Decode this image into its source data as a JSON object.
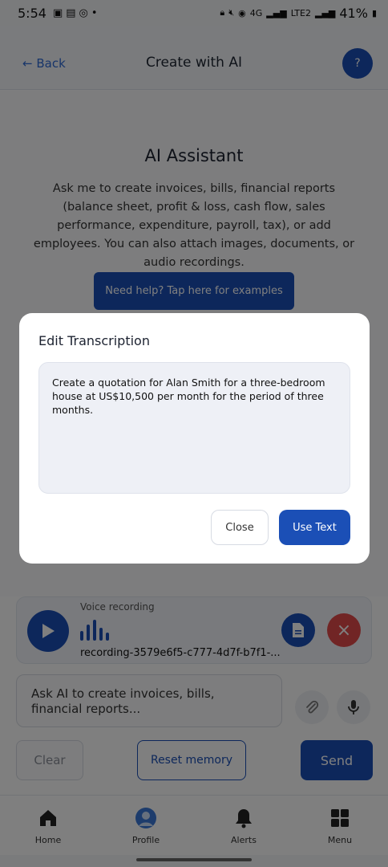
{
  "status_bar": {
    "time": "5:54",
    "battery": "41%",
    "network_4g": "4G",
    "network_lte": "LTE2"
  },
  "header": {
    "back_label": "← Back",
    "title": "Create with AI",
    "help_label": "?"
  },
  "assistant": {
    "title": "AI Assistant",
    "description": "Ask me to create invoices, bills, financial reports (balance sheet, profit & loss, cash flow, sales performance, expenditure, payroll, tax), or add employees. You can also attach images, documents, or audio recordings.",
    "examples_button": "Need help? Tap here for examples"
  },
  "voice_recording": {
    "label": "Voice recording",
    "filename": "recording-3579e6f5-c777-4d7f-b7f1-..."
  },
  "prompt": {
    "placeholder": "Ask AI to create invoices, bills, financial reports..."
  },
  "actions": {
    "clear": "Clear",
    "reset_memory": "Reset memory",
    "send": "Send"
  },
  "bottom_nav": {
    "items": [
      {
        "label": "Home",
        "icon": "home-icon"
      },
      {
        "label": "Profile",
        "icon": "profile-icon"
      },
      {
        "label": "Alerts",
        "icon": "bell-icon"
      },
      {
        "label": "Menu",
        "icon": "grid-icon"
      }
    ]
  },
  "modal": {
    "title": "Edit Transcription",
    "transcription": "Create a quotation for Alan Smith for a three-bedroom house at US$10,500 per month for the period of three months.",
    "close_label": "Close",
    "use_label": "Use Text"
  },
  "colors": {
    "primary": "#1b4fb6",
    "danger": "#e24a4a"
  }
}
